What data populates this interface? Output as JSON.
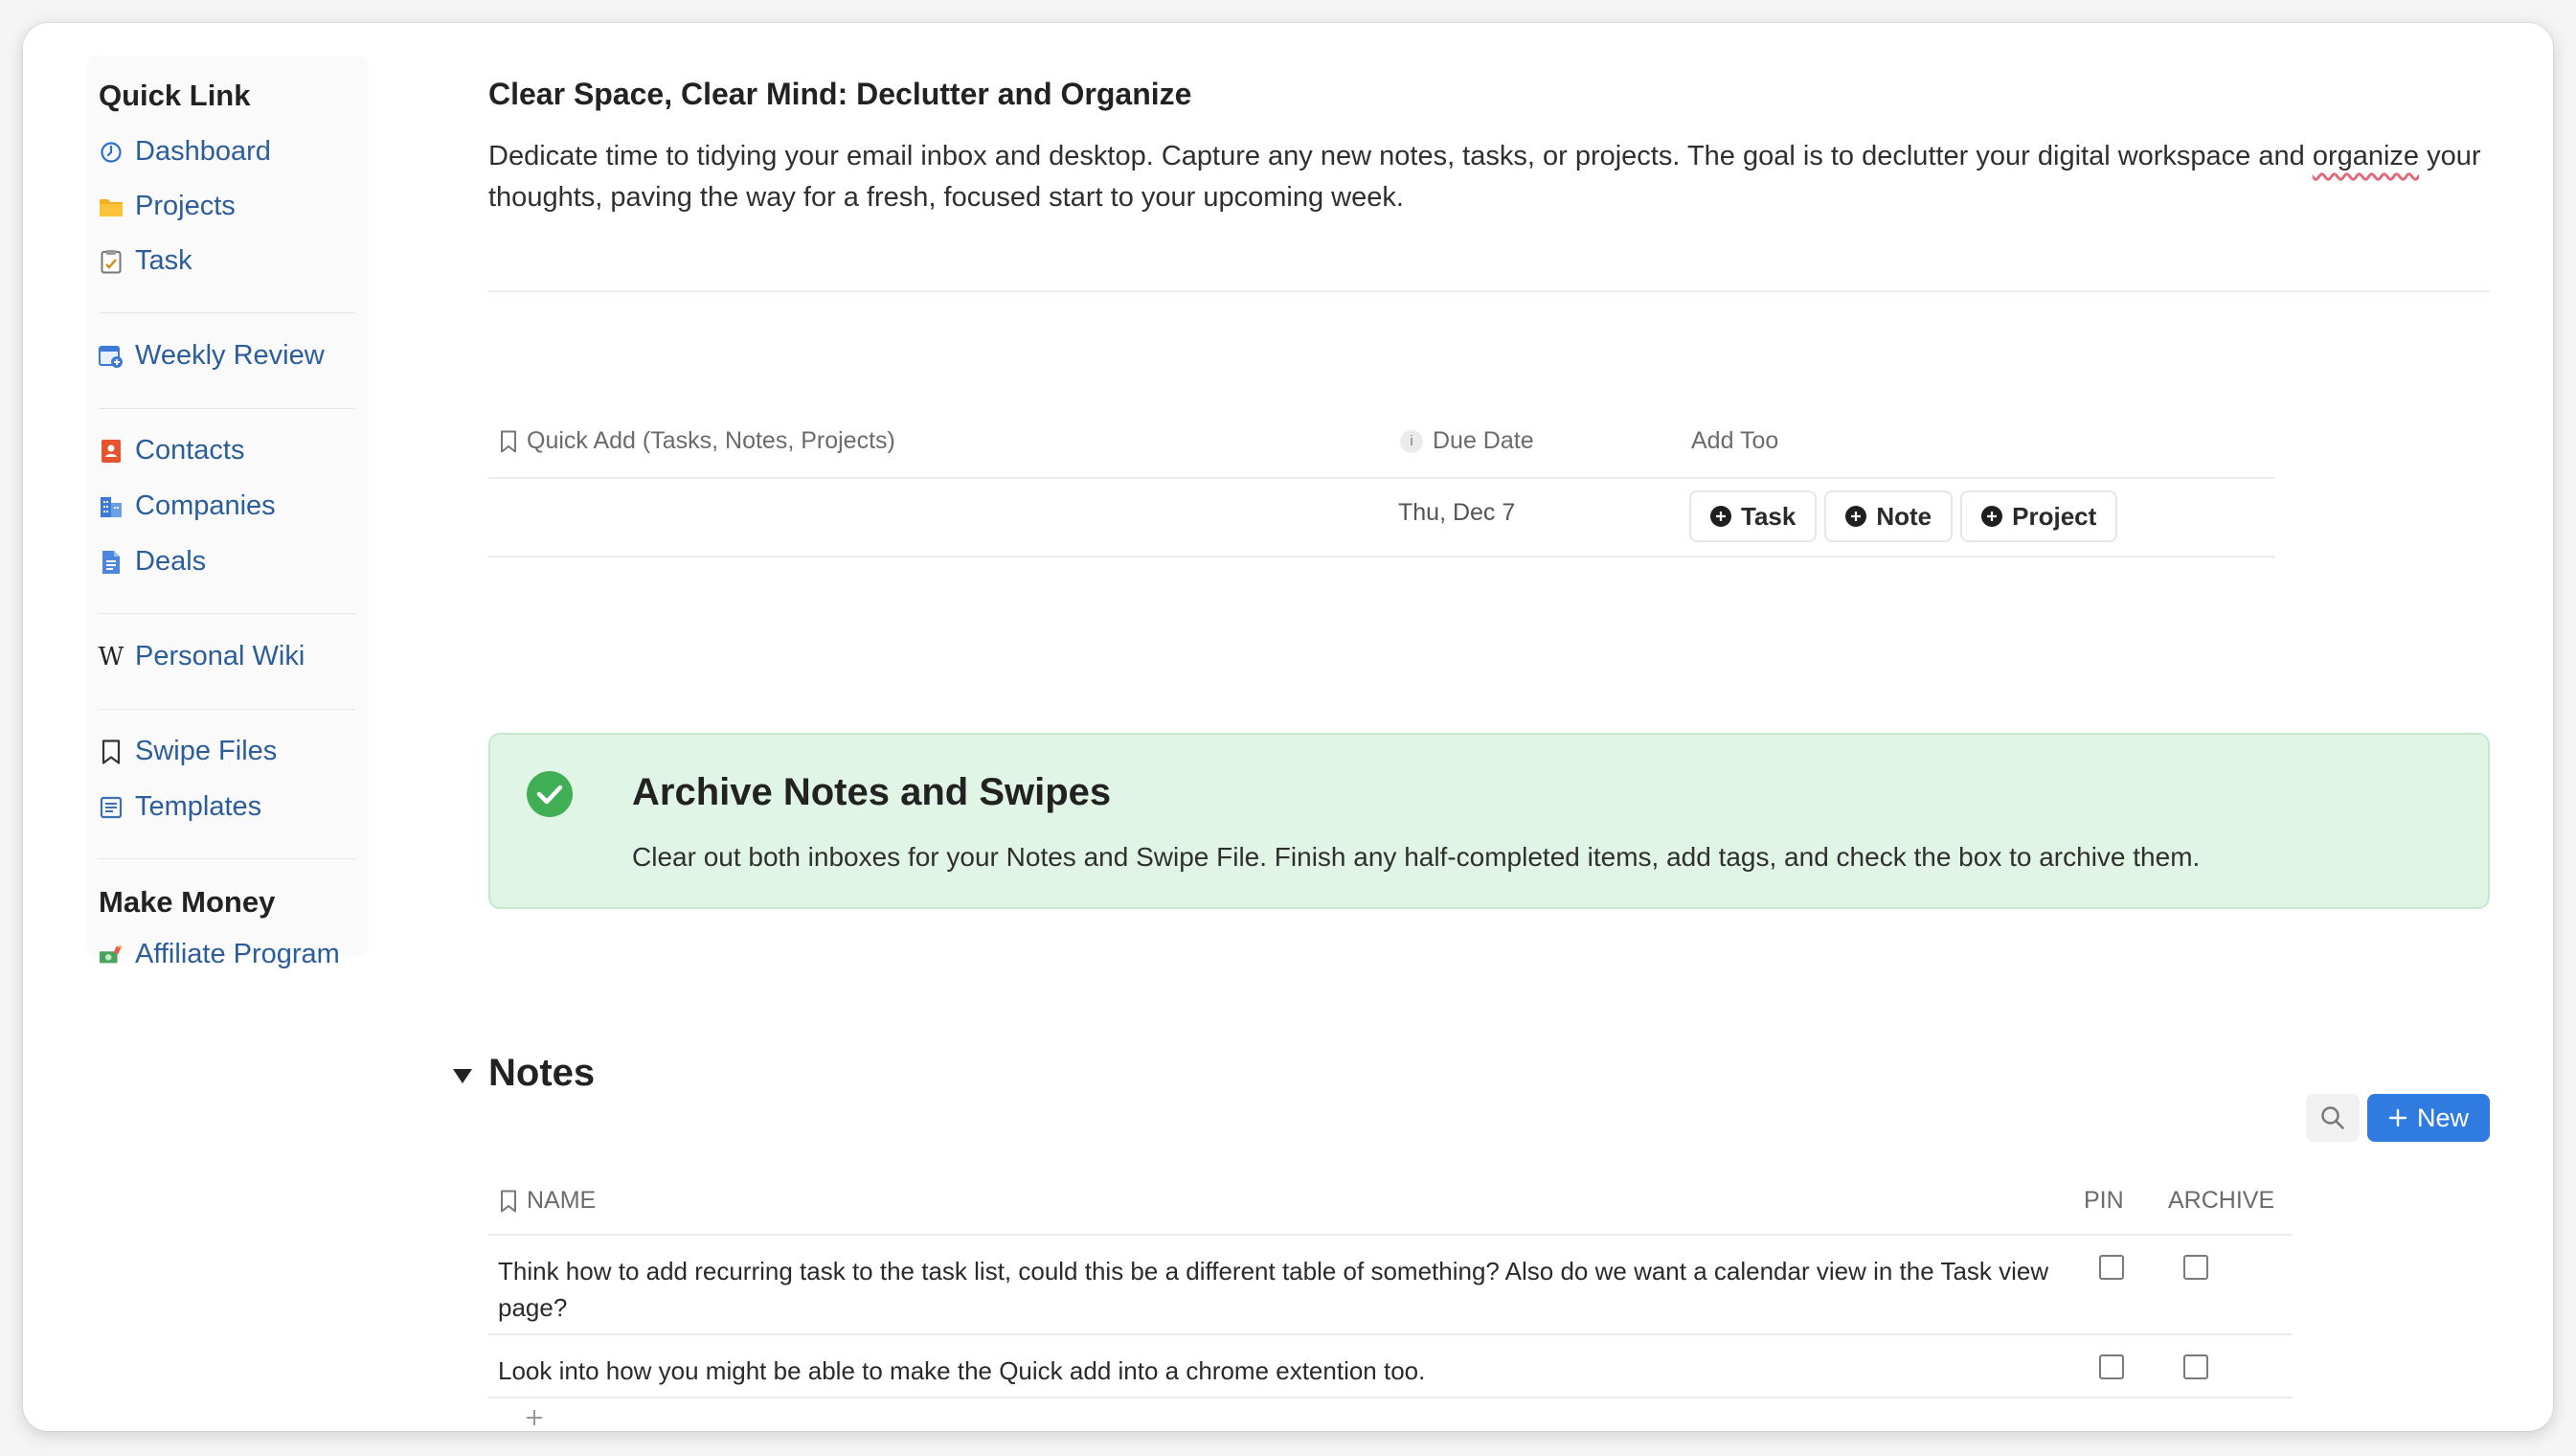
{
  "sidebar": {
    "heading": "Quick Link",
    "items": [
      {
        "label": "Dashboard",
        "icon": "dashboard-icon"
      },
      {
        "label": "Projects",
        "icon": "folder-icon"
      },
      {
        "label": "Task",
        "icon": "task-icon"
      },
      {
        "label": "Weekly Review",
        "icon": "calendar-icon"
      },
      {
        "label": "Contacts",
        "icon": "contacts-book-icon"
      },
      {
        "label": "Companies",
        "icon": "building-icon"
      },
      {
        "label": "Deals",
        "icon": "document-icon"
      },
      {
        "label": "Personal Wiki",
        "icon": "wikipedia-icon"
      },
      {
        "label": "Swipe Files",
        "icon": "bookmark-icon"
      },
      {
        "label": "Templates",
        "icon": "template-icon"
      }
    ],
    "section2_heading": "Make Money",
    "affiliate": {
      "label": "Affiliate Program",
      "icon": "money-icon"
    },
    "wiki_glyph": "W"
  },
  "main": {
    "title": "Clear Space, Clear Mind: Declutter and Organize",
    "description_part1": "Dedicate time to tidying your email inbox and desktop. Capture any new notes, tasks, or projects. The goal is to declutter your digital workspace and ",
    "description_misspelled": "organize",
    "description_part2": " your thoughts, paving the way for a fresh, focused start to your upcoming week."
  },
  "quick_add": {
    "headers": {
      "name": "Quick Add (Tasks, Notes, Projects)",
      "due": "Due Date",
      "info_glyph": "i",
      "add": "Add Too"
    },
    "row": {
      "due_value": "Thu, Dec 7",
      "buttons": [
        "Task",
        "Note",
        "Project"
      ]
    }
  },
  "callout": {
    "title": "Archive Notes and Swipes",
    "text": "Clear out both inboxes for your Notes and Swipe File. Finish any half-completed items, add tags, and check the box to archive them.",
    "color": "#e1f5e6"
  },
  "notes": {
    "heading": "Notes",
    "new_label": "New",
    "columns": {
      "name": "NAME",
      "pin": "PIN",
      "archive": "ARCHIVE"
    },
    "rows": [
      {
        "name": "Think how to add recurring task to the task list, could this be a different table of something? Also do we want a calendar view in the Task view page?",
        "pin": false,
        "archive": false
      },
      {
        "name": "Look into how you might be able to make the Quick add into a chrome extention too.",
        "pin": false,
        "archive": false
      }
    ]
  },
  "colors": {
    "link": "#2b5d9a",
    "accent": "#2f7be0",
    "success": "#3fae55"
  }
}
